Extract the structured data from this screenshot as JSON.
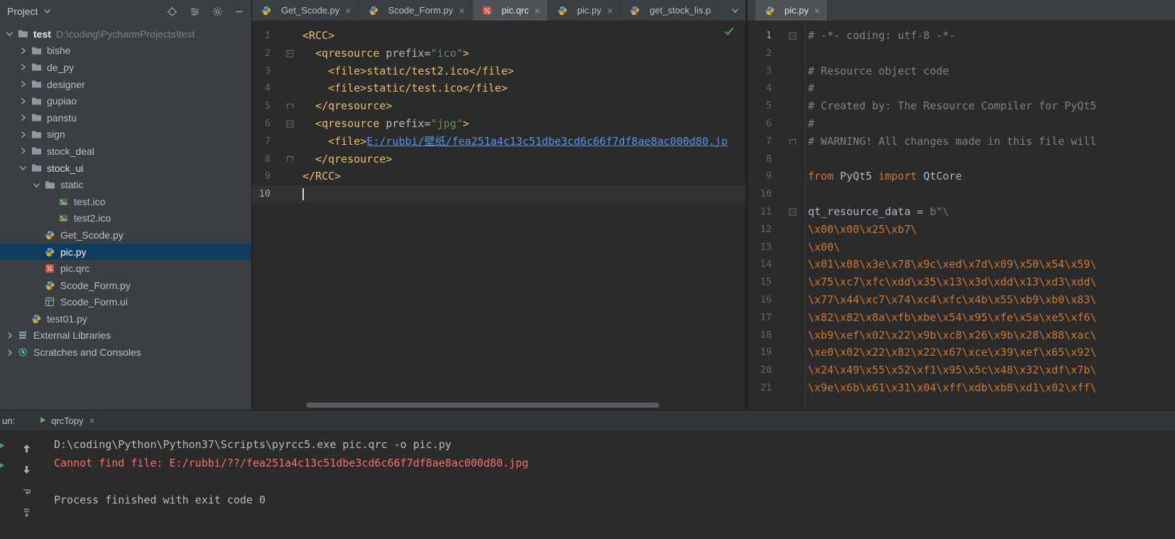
{
  "colors": {
    "background": "#2b2b2b",
    "panel": "#3c3f41",
    "selection": "#0f3b61",
    "active_tab": "#4e5254",
    "xml_tag": "#e8bf6a",
    "string_green": "#6a8759",
    "keyword_orange": "#cc7832",
    "comment_gray": "#808080",
    "text_default": "#a9b7c6",
    "link_blue": "#5394ec",
    "error_red": "#ff6b68",
    "console_text": "#bababa",
    "line_number": "#606366",
    "check_green": "#499c54"
  },
  "project_panel": {
    "header": {
      "title": "Project"
    },
    "tree": [
      {
        "label": "test",
        "path": "D:\\coding\\PycharmProjects\\test",
        "indent": 0,
        "icon": "folder",
        "chevron": "down",
        "bold": true
      },
      {
        "label": "bishe",
        "indent": 1,
        "icon": "folder",
        "chevron": "right"
      },
      {
        "label": "de_py",
        "indent": 1,
        "icon": "folder",
        "chevron": "right"
      },
      {
        "label": "designer",
        "indent": 1,
        "icon": "folder",
        "chevron": "right"
      },
      {
        "label": "gupiao",
        "indent": 1,
        "icon": "folder",
        "chevron": "right"
      },
      {
        "label": "panstu",
        "indent": 1,
        "icon": "folder",
        "chevron": "right"
      },
      {
        "label": "sign",
        "indent": 1,
        "icon": "folder",
        "chevron": "right"
      },
      {
        "label": "stock_deal",
        "indent": 1,
        "icon": "folder",
        "chevron": "right"
      },
      {
        "label": "stock_ui",
        "indent": 1,
        "icon": "folder",
        "chevron": "down",
        "bright": true
      },
      {
        "label": "static",
        "indent": 2,
        "icon": "folder",
        "chevron": "down"
      },
      {
        "label": "test.ico",
        "indent": 3,
        "icon": "image"
      },
      {
        "label": "test2.ico",
        "indent": 3,
        "icon": "image"
      },
      {
        "label": "Get_Scode.py",
        "indent": 2,
        "icon": "python"
      },
      {
        "label": "pic.py",
        "indent": 2,
        "icon": "python",
        "selected": true
      },
      {
        "label": "pic.qrc",
        "indent": 2,
        "icon": "qrc"
      },
      {
        "label": "Scode_Form.py",
        "indent": 2,
        "icon": "python"
      },
      {
        "label": "Scode_Form.ui",
        "indent": 2,
        "icon": "ui"
      },
      {
        "label": "test01.py",
        "indent": 1,
        "icon": "python"
      },
      {
        "label": "External Libraries",
        "indent": 0,
        "icon": "libs",
        "chevron": "right"
      },
      {
        "label": "Scratches and Consoles",
        "indent": 0,
        "icon": "scratch",
        "chevron": "right"
      }
    ]
  },
  "editor_left": {
    "tabs": [
      {
        "label": "Get_Scode.py",
        "icon": "python",
        "close": true
      },
      {
        "label": "Scode_Form.py",
        "icon": "python",
        "close": true
      },
      {
        "label": "pic.qrc",
        "icon": "qrc",
        "close": true,
        "active": true
      },
      {
        "label": "pic.py",
        "icon": "python",
        "close": true
      },
      {
        "label": "get_stock_lis.p",
        "icon": "python",
        "close": false
      }
    ],
    "current_line": 10,
    "lines": [
      {
        "s": [
          [
            "<RCC>",
            "tag"
          ]
        ]
      },
      {
        "fold": "start",
        "s": [
          [
            "  ",
            "plain"
          ],
          [
            "<qresource ",
            "tag"
          ],
          [
            "prefix=",
            "attr"
          ],
          [
            "\"ico\"",
            "string"
          ],
          [
            ">",
            "tag"
          ]
        ]
      },
      {
        "s": [
          [
            "    ",
            "plain"
          ],
          [
            "<file>",
            "tag"
          ],
          [
            "static/test2.ico",
            "content"
          ],
          [
            "</file>",
            "tag"
          ]
        ]
      },
      {
        "s": [
          [
            "    ",
            "plain"
          ],
          [
            "<file>",
            "tag"
          ],
          [
            "static/test.ico",
            "content"
          ],
          [
            "</file>",
            "tag"
          ]
        ]
      },
      {
        "fold": "end",
        "s": [
          [
            "  ",
            "plain"
          ],
          [
            "</qresource>",
            "tag"
          ]
        ]
      },
      {
        "fold": "start",
        "s": [
          [
            "  ",
            "plain"
          ],
          [
            "<qresource ",
            "tag"
          ],
          [
            "prefix=",
            "attr"
          ],
          [
            "\"jpg\"",
            "string"
          ],
          [
            ">",
            "tag"
          ]
        ]
      },
      {
        "s": [
          [
            "    ",
            "plain"
          ],
          [
            "<file>",
            "tag"
          ],
          [
            "E:/rubbi/壁纸/fea251a4c13c51dbe3cd6c66f7df8ae8ac000d80.jp",
            "link"
          ]
        ]
      },
      {
        "fold": "end",
        "s": [
          [
            "  ",
            "plain"
          ],
          [
            "</qresource>",
            "tag"
          ]
        ]
      },
      {
        "s": [
          [
            "</RCC>",
            "tag"
          ]
        ]
      },
      {
        "cursor": true,
        "s": []
      }
    ]
  },
  "editor_right": {
    "tabs": [
      {
        "label": "pic.py",
        "icon": "python",
        "close": true,
        "active": true
      }
    ],
    "current_line": 1,
    "lines": [
      {
        "fold": "start",
        "s": [
          [
            "# -*- coding: utf-8 -*-",
            "comment"
          ]
        ]
      },
      {
        "s": []
      },
      {
        "s": [
          [
            "# Resource object code",
            "comment"
          ]
        ]
      },
      {
        "s": [
          [
            "#",
            "comment"
          ]
        ]
      },
      {
        "s": [
          [
            "# Created by: The Resource Compiler for PyQt5",
            "comment"
          ]
        ]
      },
      {
        "s": [
          [
            "#",
            "comment"
          ]
        ]
      },
      {
        "fold": "end",
        "s": [
          [
            "# WARNING! All changes made in this file will",
            "comment"
          ]
        ]
      },
      {
        "s": []
      },
      {
        "s": [
          [
            "from",
            "keyword"
          ],
          [
            " PyQt5 ",
            "plain"
          ],
          [
            "import",
            "keyword"
          ],
          [
            " QtCore",
            "plain"
          ]
        ]
      },
      {
        "s": []
      },
      {
        "fold": "start",
        "s": [
          [
            "qt_resource_data = ",
            "plain"
          ],
          [
            "b\"\\",
            "string"
          ]
        ]
      },
      {
        "s": [
          [
            "\\x00\\x00\\x25\\xb7\\",
            "esc"
          ]
        ]
      },
      {
        "s": [
          [
            "\\x00\\",
            "esc"
          ]
        ]
      },
      {
        "s": [
          [
            "\\x01\\x08\\x3e\\x78\\x9c\\xed\\x7d\\x09\\x50\\x54\\x59\\",
            "esc"
          ]
        ]
      },
      {
        "s": [
          [
            "\\x75\\xc7\\xfc\\xdd\\x35\\x13\\x3d\\xdd\\x13\\xd3\\xdd\\",
            "esc"
          ]
        ]
      },
      {
        "s": [
          [
            "\\x77\\x44\\xc7\\x74\\xc4\\xfc\\x4b\\x55\\xb9\\xb0\\x83\\",
            "esc"
          ]
        ]
      },
      {
        "s": [
          [
            "\\x82\\x82\\x8a\\xfb\\xbe\\x54\\x95\\xfe\\x5a\\xe5\\xf6\\",
            "esc"
          ]
        ]
      },
      {
        "s": [
          [
            "\\xb9\\xef\\x02\\x22\\x9b\\xc8\\x26\\x9b\\x28\\x88\\xac\\",
            "esc"
          ]
        ]
      },
      {
        "s": [
          [
            "\\xe0\\x02\\x22\\x82\\x22\\x67\\xce\\x39\\xef\\x65\\x92\\",
            "esc"
          ]
        ]
      },
      {
        "s": [
          [
            "\\x24\\x49\\x55\\x52\\xf1\\x95\\x5c\\x48\\x32\\xdf\\x7b\\",
            "esc"
          ]
        ]
      },
      {
        "s": [
          [
            "\\x9e\\x6b\\x61\\x31\\x04\\xff\\xdb\\xb8\\xd1\\x02\\xff\\",
            "esc"
          ]
        ]
      }
    ]
  },
  "run_panel": {
    "label": "un:",
    "tab": {
      "label": "qrcTopy"
    },
    "console": [
      {
        "text": "D:\\coding\\Python\\Python37\\Scripts\\pyrcc5.exe pic.qrc -o pic.py",
        "style": "normal"
      },
      {
        "text": "Cannot find file: E:/rubbi/??/fea251a4c13c51dbe3cd6c66f7df8ae8ac000d80.jpg",
        "style": "error"
      },
      {
        "text": "",
        "style": "normal"
      },
      {
        "text": "Process finished with exit code 0",
        "style": "normal"
      }
    ]
  }
}
